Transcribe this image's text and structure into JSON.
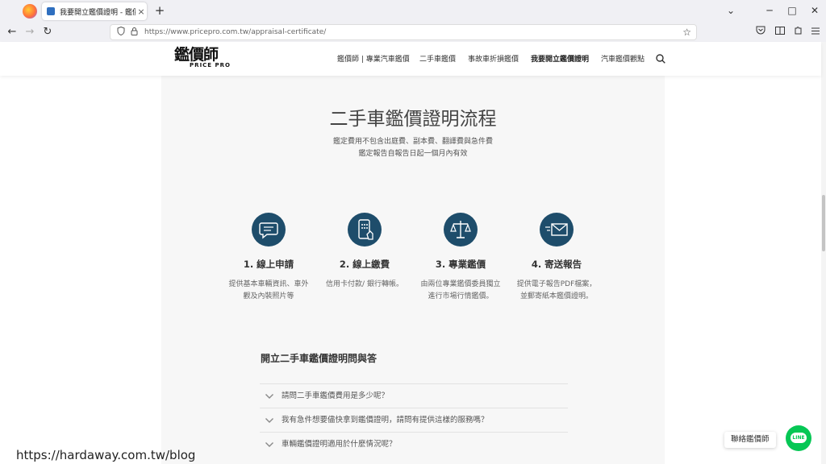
{
  "browser": {
    "tab_title": "我要開立鑑價證明 - 鑑價師 | 影",
    "tab_close": "×",
    "new_tab": "+",
    "url": "https://www.pricepro.com.tw/appraisal-certificate/",
    "back": "←",
    "forward": "→",
    "reload": "↻",
    "minimize": "─",
    "maximize": "□",
    "close": "✕",
    "tab_list": "⌄"
  },
  "site": {
    "logo_text": "鑑價師",
    "logo_sub": "PRICE PRO",
    "nav": [
      {
        "label": "鑑價師 | 專業汽車鑑價"
      },
      {
        "label": "二手車鑑價"
      },
      {
        "label": "事故車折損鑑價"
      },
      {
        "label": "我要開立鑑價證明"
      },
      {
        "label": "汽車鑑價觀點"
      }
    ]
  },
  "main": {
    "title": "二手車鑑價證明流程",
    "subtitle_1": "鑑定費用不包含出庭費、副本費、翻譯費與急件費",
    "subtitle_2": "鑑定報告自報告日起一個月內有效",
    "steps": [
      {
        "title": "1. 線上申請",
        "desc": "提供基本車輛資訊、車外觀及內裝照片等",
        "icon": "chat-bubble-icon"
      },
      {
        "title": "2. 線上繳費",
        "desc": "信用卡付款/ 銀行轉帳。",
        "icon": "mobile-payment-icon"
      },
      {
        "title": "3. 專業鑑價",
        "desc": "由兩位專業鑑價委員獨立進行市場行情鑑價。",
        "icon": "scale-icon"
      },
      {
        "title": "4. 寄送報告",
        "desc": "提供電子報告PDF檔案，並郵寄紙本鑑價證明。",
        "icon": "envelope-icon"
      }
    ],
    "faq_heading": "開立二手車鑑價證明問與答",
    "faq": [
      {
        "q": "請問二手車鑑價費用是多少呢？"
      },
      {
        "q": "我有急件想要儘快拿到鑑價證明，請問有提供這樣的服務嗎？"
      },
      {
        "q": "車輛鑑價證明適用於什麼情況呢？"
      }
    ]
  },
  "widgets": {
    "contact_label": "聯絡鑑價師",
    "line_label": "LINE"
  },
  "watermark": "https://hardaway.com.tw/blog",
  "colors": {
    "accent": "#1e4d6b",
    "brand_red": "#d01c1f",
    "line_green": "#06c755"
  }
}
